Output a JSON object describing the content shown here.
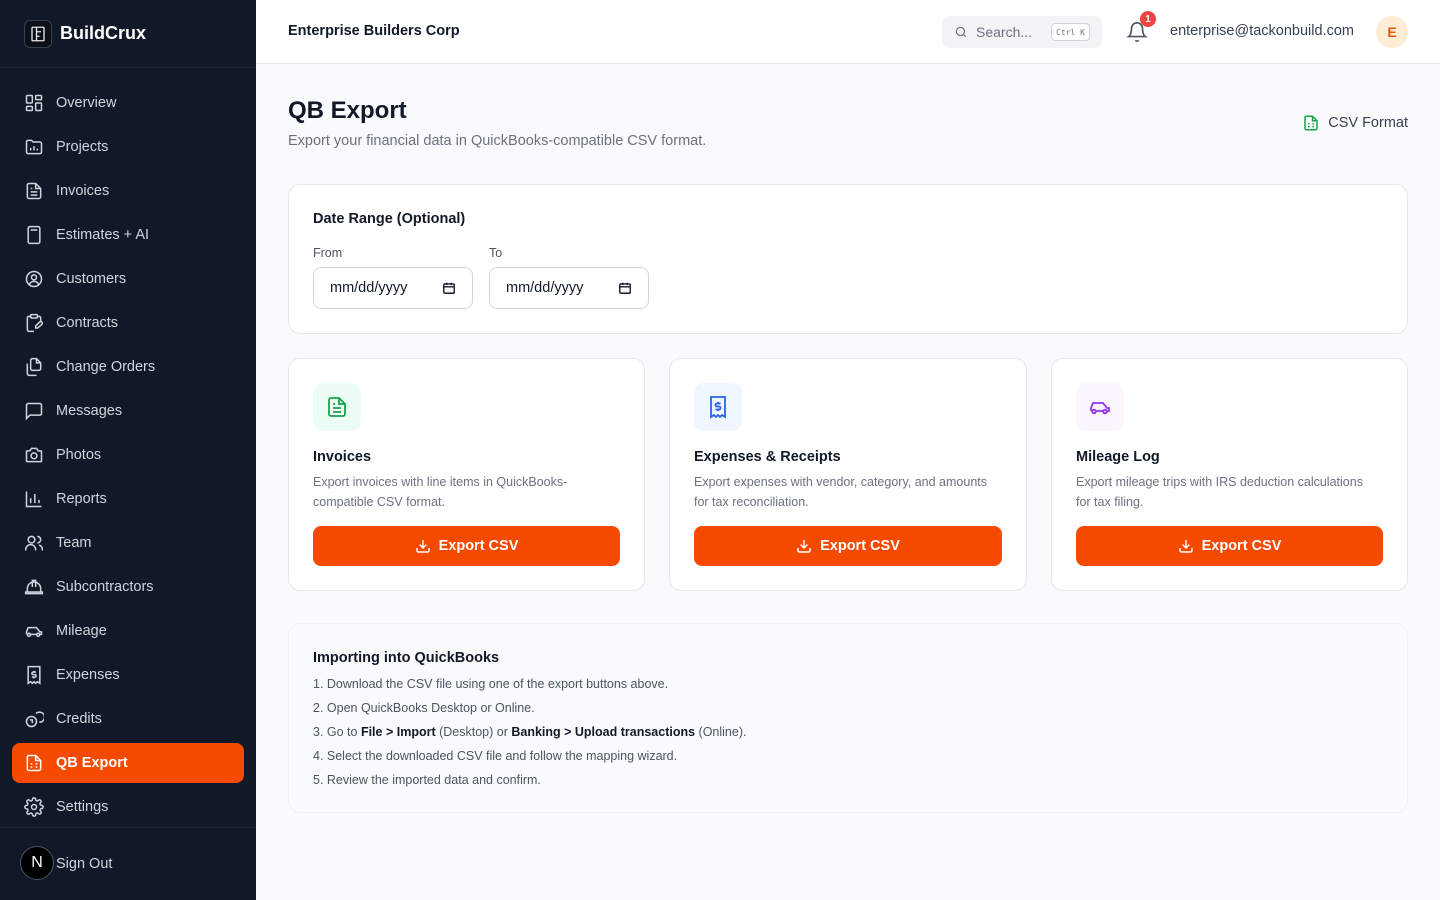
{
  "brand": {
    "name": "BuildCrux"
  },
  "sidebar": {
    "items": [
      {
        "label": "Overview",
        "icon": "grid-icon"
      },
      {
        "label": "Projects",
        "icon": "folder-chart-icon"
      },
      {
        "label": "Invoices",
        "icon": "file-text-icon"
      },
      {
        "label": "Estimates + AI",
        "icon": "calculator-icon"
      },
      {
        "label": "Customers",
        "icon": "user-circle-icon"
      },
      {
        "label": "Contracts",
        "icon": "clipboard-pen-icon"
      },
      {
        "label": "Change Orders",
        "icon": "files-icon"
      },
      {
        "label": "Messages",
        "icon": "message-square-icon"
      },
      {
        "label": "Photos",
        "icon": "camera-icon"
      },
      {
        "label": "Reports",
        "icon": "bar-chart-icon"
      },
      {
        "label": "Team",
        "icon": "users-icon"
      },
      {
        "label": "Subcontractors",
        "icon": "hard-hat-icon"
      },
      {
        "label": "Mileage",
        "icon": "car-icon"
      },
      {
        "label": "Expenses",
        "icon": "receipt-dollar-icon"
      },
      {
        "label": "Credits",
        "icon": "coins-icon"
      },
      {
        "label": "QB Export",
        "icon": "file-spreadsheet-icon",
        "active": true
      },
      {
        "label": "Settings",
        "icon": "gear-icon"
      }
    ],
    "signout": {
      "badge": "N",
      "label": "Sign Out"
    }
  },
  "header": {
    "org_name": "Enterprise Builders Corp",
    "search_placeholder": "Search...",
    "search_shortcut": "Ctrl K",
    "notification_count": "1",
    "user_email": "enterprise@tackonbuild.com",
    "avatar_initial": "E"
  },
  "page": {
    "title": "QB Export",
    "subtitle": "Export your financial data in QuickBooks-compatible CSV format.",
    "format_badge": "CSV Format"
  },
  "date_range": {
    "title": "Date Range (Optional)",
    "from_label": "From",
    "to_label": "To",
    "from_value": "mm/dd/yyyy",
    "to_value": "mm/dd/yyyy"
  },
  "exports": [
    {
      "title": "Invoices",
      "description": "Export invoices with line items in QuickBooks-compatible CSV format.",
      "button": "Export CSV",
      "icon": "file-text-icon",
      "tile_color": "#ecfdf5",
      "icon_color": "#16a34a"
    },
    {
      "title": "Expenses & Receipts",
      "description": "Export expenses with vendor, category, and amounts for tax reconciliation.",
      "button": "Export CSV",
      "icon": "receipt-dollar-icon",
      "tile_color": "#eff6ff",
      "icon_color": "#2563eb"
    },
    {
      "title": "Mileage Log",
      "description": "Export mileage trips with IRS deduction calculations for tax filing.",
      "button": "Export CSV",
      "icon": "car-icon",
      "tile_color": "#faf5ff",
      "icon_color": "#9333ea"
    }
  ],
  "import_guide": {
    "title": "Importing into QuickBooks",
    "steps": {
      "s1": "1. Download the CSV file using one of the export buttons above.",
      "s2": "2. Open QuickBooks Desktop or Online.",
      "s3_a": "3. Go to ",
      "s3_b": "File > Import",
      "s3_c": " (Desktop) or ",
      "s3_d": "Banking > Upload transactions",
      "s3_e": " (Online).",
      "s4": "4. Select the downloaded CSV file and follow the mapping wizard.",
      "s5": "5. Review the imported data and confirm."
    }
  },
  "colors": {
    "accent": "#f54a00",
    "sidebar_bg": "#111827"
  }
}
